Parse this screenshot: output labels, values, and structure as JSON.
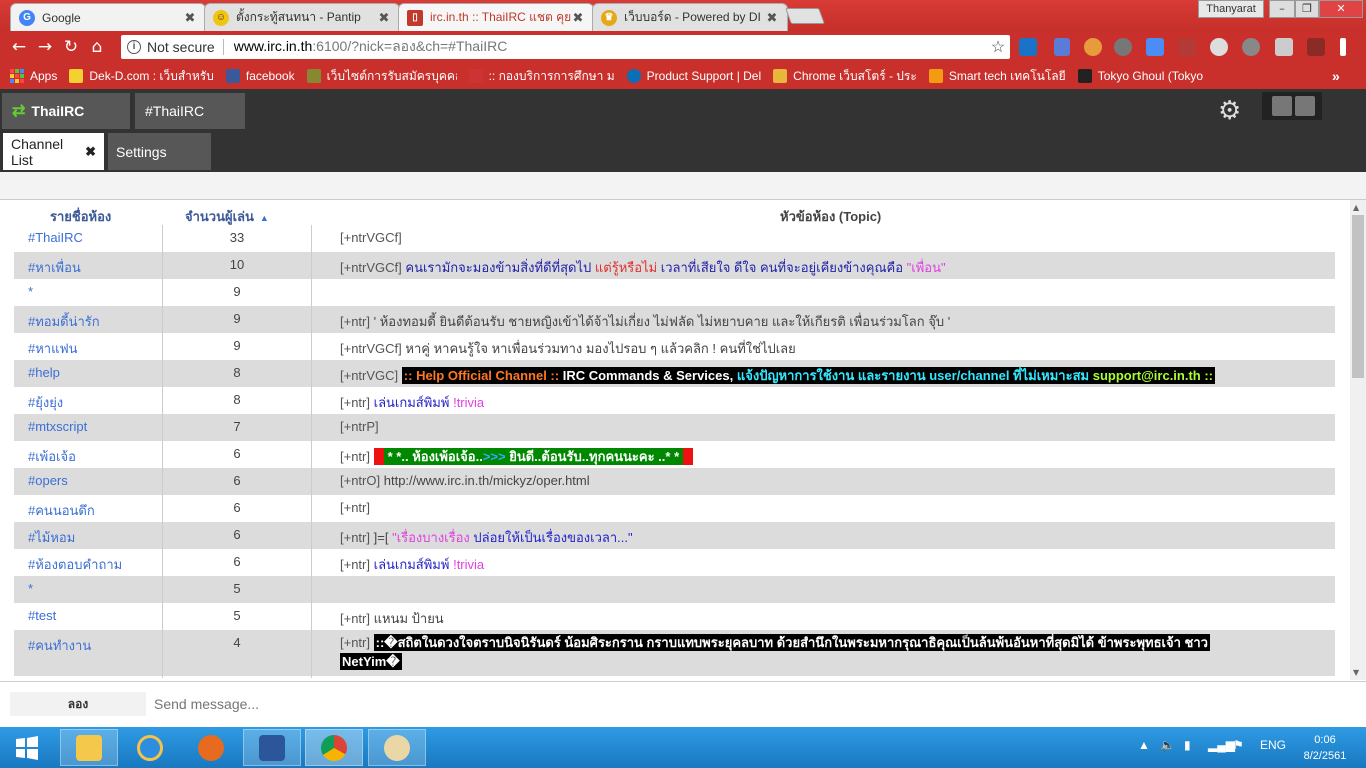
{
  "browser": {
    "tabs": [
      {
        "title": "Google",
        "color": "#4285f4",
        "glyph": "G"
      },
      {
        "title": "ตั้งกระทู้สนทนา - Pantip",
        "color": "#f1c40f",
        "glyph": "☺"
      },
      {
        "title": "irc.in.th :: ThaiIRC แชต คุย",
        "color": "#c0392b",
        "glyph": "▯"
      },
      {
        "title": "เว็บบอร์ด - Powered by DI",
        "color": "#e6a817",
        "glyph": "♛"
      }
    ],
    "user_name": "Thanyarat",
    "window_minimize": "–",
    "window_maximize": "❐",
    "window_close": "✕",
    "security_label": "Not secure",
    "url_host": "www.irc.in.th",
    "url_rest": ":6100/?nick=ลอง&ch=#ThaiIRC",
    "bookmarks": [
      {
        "label": "Apps"
      },
      {
        "label": "Dek-D.com : เว็บสำหรับ",
        "color": "#f5d033"
      },
      {
        "label": "facebook",
        "color": "#3b5998"
      },
      {
        "label": "เว็บไซต์การรับสมัครบุคคล",
        "color": "#888833"
      },
      {
        "label": ":: กองบริการการศึกษา ม",
        "color": "#cc3333"
      },
      {
        "label": "Product Support | Del",
        "color": "#0b6fb8"
      },
      {
        "label": "Chrome เว็บสโตร์ - ประ",
        "color": "#e8b63a"
      },
      {
        "label": "Smart tech เทคโนโลยี",
        "color": "#f39c12"
      },
      {
        "label": "Tokyo Ghoul (Tokyo",
        "color": "#222222"
      }
    ],
    "more_bookmarks": "»"
  },
  "irc": {
    "network_tab": "ThaiIRC",
    "channel_tab": "#ThaiIRC",
    "sub_tabs": {
      "channel_list": "Channel List",
      "settings": "Settings"
    },
    "close_glyph": "✖",
    "headers": {
      "name": "รายชื่อห้อง",
      "users": "จำนวนผู้เล่น",
      "topic": "หัวข้อห้อง (Topic)",
      "sort": "▲"
    },
    "rows": [
      {
        "name": "#ThaiIRC",
        "count": "33",
        "mode": "[+ntrVGCf]"
      },
      {
        "name": "#หาเพื่อน",
        "count": "10",
        "mode": "[+ntrVGCf]"
      },
      {
        "name": "*",
        "count": "9",
        "mode": ""
      },
      {
        "name": "#ทอมดี้น่ารัก",
        "count": "9",
        "mode": "[+ntr]"
      },
      {
        "name": "#หาแฟน",
        "count": "9",
        "mode": "[+ntrVGCf]"
      },
      {
        "name": "#help",
        "count": "8",
        "mode": "[+ntrVGC]"
      },
      {
        "name": "#ยุ้งยุ่ง",
        "count": "8",
        "mode": "[+ntr]"
      },
      {
        "name": "#mtxscript",
        "count": "7",
        "mode": "[+ntrP]"
      },
      {
        "name": "#เพ้อเจ้อ",
        "count": "6",
        "mode": "[+ntr]"
      },
      {
        "name": "#opers",
        "count": "6",
        "mode": "[+ntrO]"
      },
      {
        "name": "#คนนอนดึก",
        "count": "6",
        "mode": "[+ntr]"
      },
      {
        "name": "#ไม้หอม",
        "count": "6",
        "mode": "[+ntr]"
      },
      {
        "name": "#ห้องตอบคำถาม",
        "count": "6",
        "mode": "[+ntr]"
      },
      {
        "name": "*",
        "count": "5",
        "mode": ""
      },
      {
        "name": "#test",
        "count": "5",
        "mode": "[+ntr]"
      },
      {
        "name": "#คนทำงาน",
        "count": "4",
        "mode": "[+ntr]"
      }
    ],
    "topics": {
      "hapuen_a": "คนเรามักจะมองข้ามสิ่งที่ดีที่สุดไป",
      "hapuen_b": "แต่รู้หรือไม่",
      "hapuen_c": "เวลาที่เสียใจ ดีใจ คนที่จะอยู่เคียงข้างคุณคือ",
      "hapuen_d": "\"เพื่อน\"",
      "tomdee": "' ห้องทอมดี้ ยินดีต้อนรับ ชายหญิงเข้าได้จ้าไม่เกี่ยง ไม่ฟลัด ไม่หยาบคาย และให้เกียรติ เพื่อนร่วมโลก จุ๊บ '",
      "hafan": "หาคู่ หาคนรู้ใจ หาเพื่อนร่วมทาง มองไปรอบ ๆ แล้วคลิก ! คนที่ใช่ไปเลย",
      "help_a": ":: Help Official Channel ::",
      "help_b": "IRC Commands & Services,",
      "help_c": "แจ้งปัญหาการใช้งาน และรายงาน user/channel ที่ไม่เหมาะสม",
      "help_d": "support@irc.in.th ::",
      "game_a": "เล่นเกมส์พิมพ์",
      "game_b": "!trivia",
      "pher_a": "* *.. ห้องเพ้อเจ้อ..",
      "pher_b": ">>>",
      "pher_c": "ยินดี..ต้อนรับ..ทุกคนนะคะ ..* *",
      "opers": "http://www.irc.in.th/mickyz/oper.html",
      "maihom_a": "]=[",
      "maihom_b": "\"เรื่องบางเรื่อง",
      "maihom_c": "ปล่อยให้เป็นเรื่องของเวลา...\"",
      "test": "แหนม ป้ายน",
      "work_a": "::�สถิตในดวงใจตราบนิจนิรันดร์ น้อมศิระกราน กราบแทบพระยุคลบาท ด้วยสำนึกในพระมหากรุณาธิคุณเป็นล้นพ้นอันหาที่สุดมิได้ ข้าพระพุทธเจ้า ชาว",
      "work_b": "NetYim�"
    },
    "nick": "ลอง",
    "message_placeholder": "Send message..."
  },
  "taskbar": {
    "language": "ENG",
    "time": "0:06",
    "date": "8/2/2561"
  }
}
